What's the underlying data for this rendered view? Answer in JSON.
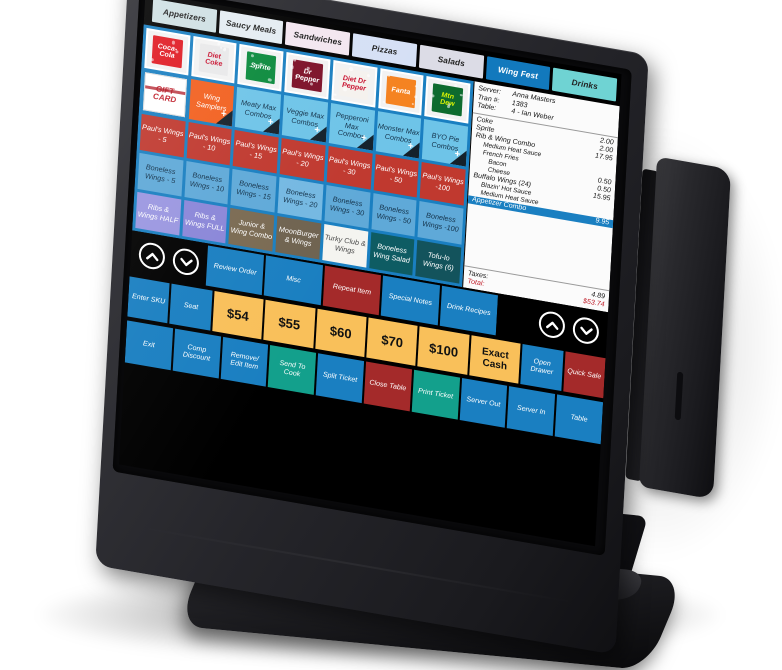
{
  "device": {
    "type": "touchscreen-pos-terminal",
    "peripheral": "magnetic-stripe-reader"
  },
  "colors": {
    "accent_blue": "#1a7fc1",
    "grid_bg": "#1a7fc1",
    "red": "#c0392f",
    "dark_red": "#a42a2a",
    "light_blue": "#6ec4e8",
    "purple": "#8a86d8",
    "brown": "#7a6a52",
    "teal_dark": "#0e5c63",
    "teal": "#13a08c",
    "amber": "#f9c05a",
    "white": "#ffffff",
    "total_red": "#c0202c",
    "selected_row": "#1a7fc1"
  },
  "tabs": [
    {
      "label": "Appetizers",
      "bg": "#cfe0e3",
      "selected": false
    },
    {
      "label": "Saucy Meals",
      "bg": "#e4ecf2",
      "selected": false
    },
    {
      "label": "Sandwiches",
      "bg": "#f3e6f0",
      "selected": false
    },
    {
      "label": "Pizzas",
      "bg": "#d5e0f5",
      "selected": false
    },
    {
      "label": "Salads",
      "bg": "#dcdce6",
      "selected": false
    },
    {
      "label": "Wing Fest",
      "bg": "#1279bd",
      "selected": true
    },
    {
      "label": "Drinks",
      "bg": "#6fd3d3",
      "selected": false
    }
  ],
  "grid": {
    "rows": [
      {
        "kind": "images",
        "cells": [
          {
            "label": "Coca-Cola",
            "brand": "Coca-Cola",
            "bg": "#e01a22",
            "fg": "#ffffff"
          },
          {
            "label": "Diet Coke",
            "brand": "Diet Coke",
            "bg": "#e9e9ea",
            "fg": "#c8102e"
          },
          {
            "label": "Sprite",
            "brand": "Sprite",
            "bg": "#0a8a3c",
            "fg": "#ffffff"
          },
          {
            "label": "Dr Pepper",
            "brand": "Dr Pepper",
            "bg": "#7d1128",
            "fg": "#ffffff"
          },
          {
            "label": "Diet Dr Pepper",
            "brand": "Diet Dr Pepper",
            "bg": "#f5f2ee",
            "fg": "#c8102e"
          },
          {
            "label": "Fanta",
            "brand": "Fanta",
            "bg": "#f5821f",
            "fg": "#ffffff"
          },
          {
            "label": "Mountain Dew",
            "brand": "Mtn Dew",
            "bg": "#0d6b2e",
            "fg": "#d7f205"
          }
        ]
      },
      {
        "kind": "combos",
        "cells": [
          {
            "label": "GIFT CARD",
            "style": "giftcard",
            "plus": false
          },
          {
            "label": "Wing Samplers",
            "bg": "#f2601f",
            "fg": "#ffffff",
            "plus": true
          },
          {
            "label": "Meaty Max Combos",
            "bg": "#6ec4e8",
            "fg": "#14324a",
            "plus": true
          },
          {
            "label": "Veggie Max Combos",
            "bg": "#6ec4e8",
            "fg": "#14324a",
            "plus": true
          },
          {
            "label": "Pepperoni Max Combos",
            "bg": "#6ec4e8",
            "fg": "#14324a",
            "plus": true
          },
          {
            "label": "Monster Max Combos",
            "bg": "#6ec4e8",
            "fg": "#14324a",
            "plus": true
          },
          {
            "label": "BYO Pie Combos",
            "bg": "#6ec4e8",
            "fg": "#14324a",
            "plus": true
          }
        ]
      },
      {
        "kind": "wings",
        "cells": [
          {
            "label": "Paul's Wings - 5",
            "bg": "#c0392f",
            "fg": "#ffffff"
          },
          {
            "label": "Paul's Wings - 10",
            "bg": "#c0392f",
            "fg": "#ffffff"
          },
          {
            "label": "Paul's Wings - 15",
            "bg": "#c0392f",
            "fg": "#ffffff"
          },
          {
            "label": "Paul's Wings - 20",
            "bg": "#c0392f",
            "fg": "#ffffff"
          },
          {
            "label": "Paul's Wings - 30",
            "bg": "#c0392f",
            "fg": "#ffffff"
          },
          {
            "label": "Paul's Wings - 50",
            "bg": "#c0392f",
            "fg": "#ffffff"
          },
          {
            "label": "Paul's Wings -100",
            "bg": "#c0392f",
            "fg": "#ffffff"
          }
        ]
      },
      {
        "kind": "boneless",
        "cells": [
          {
            "label": "Boneless Wings - 5",
            "bg": "#5fa9d8",
            "fg": "#14324a"
          },
          {
            "label": "Boneless Wings - 10",
            "bg": "#5fa9d8",
            "fg": "#14324a"
          },
          {
            "label": "Boneless Wings - 15",
            "bg": "#5fa9d8",
            "fg": "#14324a"
          },
          {
            "label": "Boneless Wings - 20",
            "bg": "#74b8e2",
            "fg": "#14324a"
          },
          {
            "label": "Boneless Wings - 30",
            "bg": "#5fa9d8",
            "fg": "#14324a"
          },
          {
            "label": "Boneless Wings - 50",
            "bg": "#5fa9d8",
            "fg": "#14324a"
          },
          {
            "label": "Boneless Wings -100",
            "bg": "#5fa9d8",
            "fg": "#14324a"
          }
        ]
      },
      {
        "kind": "specials",
        "cells": [
          {
            "label": "Ribs & Wings HALF",
            "bg": "#9a96e0",
            "fg": "#ffffff"
          },
          {
            "label": "Ribs & Wings FULL",
            "bg": "#8a86d8",
            "fg": "#ffffff"
          },
          {
            "label": "Junior & Wing Combo",
            "bg": "#7a6a52",
            "fg": "#ffffff"
          },
          {
            "label": "MoonBurger & Wings",
            "bg": "#6f6350",
            "fg": "#ffffff"
          },
          {
            "label": "Turky Club & Wings",
            "bg": "#f4f4f0",
            "fg": "#4a4a4a"
          },
          {
            "label": "Boneless Wing Salad",
            "bg": "#0e5c63",
            "fg": "#ffffff"
          },
          {
            "label": "Tofu-lo Wings (6)",
            "bg": "#13535c",
            "fg": "#ffffff"
          }
        ]
      }
    ]
  },
  "receipt": {
    "server_label": "Server:",
    "server_value": "Anna Masters",
    "tran_label": "Tran #:",
    "tran_value": "1383",
    "table_label": "Table:",
    "table_value": "4 - Ian Weber",
    "items": [
      {
        "name": "Coke",
        "price": "2.00",
        "level": 0,
        "selected": false
      },
      {
        "name": "Sprite",
        "price": "2.00",
        "level": 0,
        "selected": false
      },
      {
        "name": "Rib & Wing Combo",
        "price": "17.95",
        "level": 0,
        "selected": false
      },
      {
        "name": "Medium Heat Sauce",
        "price": "",
        "level": 1,
        "selected": false
      },
      {
        "name": "French Fries",
        "price": "",
        "level": 1,
        "selected": false
      },
      {
        "name": "Bacon",
        "price": "0.50",
        "level": 2,
        "selected": false
      },
      {
        "name": "Cheese",
        "price": "0.50",
        "level": 2,
        "selected": false
      },
      {
        "name": "Buffalo Wings (24)",
        "price": "15.95",
        "level": 0,
        "selected": false
      },
      {
        "name": "Blazin' Hot Sauce",
        "price": "",
        "level": 1,
        "selected": false
      },
      {
        "name": "Medium Heat Sauce",
        "price": "",
        "level": 1,
        "selected": false
      },
      {
        "name": "Appetizer Combo",
        "price": "9.95",
        "level": 0,
        "selected": true
      }
    ],
    "taxes_label": "Taxes:",
    "taxes_value": "4.89",
    "total_label": "Total:",
    "total_value": "$53.74"
  },
  "function_bar": {
    "left_scroll_up": "scroll-up",
    "left_scroll_down": "scroll-down",
    "right_scroll_up": "scroll-up",
    "right_scroll_down": "scroll-down",
    "buttons": [
      {
        "label": "Review Order",
        "bg": "#1a7fc1"
      },
      {
        "label": "Misc",
        "bg": "#1a7fc1"
      },
      {
        "label": "Repeat Item",
        "bg": "#a42a2a"
      },
      {
        "label": "Special Notes",
        "bg": "#1a7fc1"
      },
      {
        "label": "Drink Recipes",
        "bg": "#1a7fc1"
      }
    ]
  },
  "pay_row": [
    {
      "label": "Enter SKU",
      "bg": "#1a7fc1",
      "kind": "text"
    },
    {
      "label": "Seat",
      "bg": "#1a7fc1",
      "kind": "text"
    },
    {
      "label": "$54",
      "bg": "#f9c05a",
      "kind": "amount"
    },
    {
      "label": "$55",
      "bg": "#f9c05a",
      "kind": "amount"
    },
    {
      "label": "$60",
      "bg": "#f9c05a",
      "kind": "amount"
    },
    {
      "label": "$70",
      "bg": "#f9c05a",
      "kind": "amount"
    },
    {
      "label": "$100",
      "bg": "#f9c05a",
      "kind": "amount"
    },
    {
      "label": "Exact Cash",
      "bg": "#f9c05a",
      "kind": "exact"
    },
    {
      "label": "Open Drawer",
      "bg": "#1a7fc1",
      "kind": "text"
    },
    {
      "label": "Quick Sale",
      "bg": "#a42a2a",
      "kind": "text"
    }
  ],
  "action_row": [
    {
      "label": "Exit",
      "bg": "#1a7fc1"
    },
    {
      "label": "Comp Discount",
      "bg": "#1a7fc1"
    },
    {
      "label": "Remove/ Edit Item",
      "bg": "#1a7fc1"
    },
    {
      "label": "Send To Cook",
      "bg": "#13a08c"
    },
    {
      "label": "Split Ticket",
      "bg": "#1a7fc1"
    },
    {
      "label": "Close Table",
      "bg": "#a42a2a"
    },
    {
      "label": "Print Ticket",
      "bg": "#13a08c"
    },
    {
      "label": "Server Out",
      "bg": "#1a7fc1"
    },
    {
      "label": "Server  In",
      "bg": "#1a7fc1"
    },
    {
      "label": "Table",
      "bg": "#1a7fc1"
    }
  ]
}
